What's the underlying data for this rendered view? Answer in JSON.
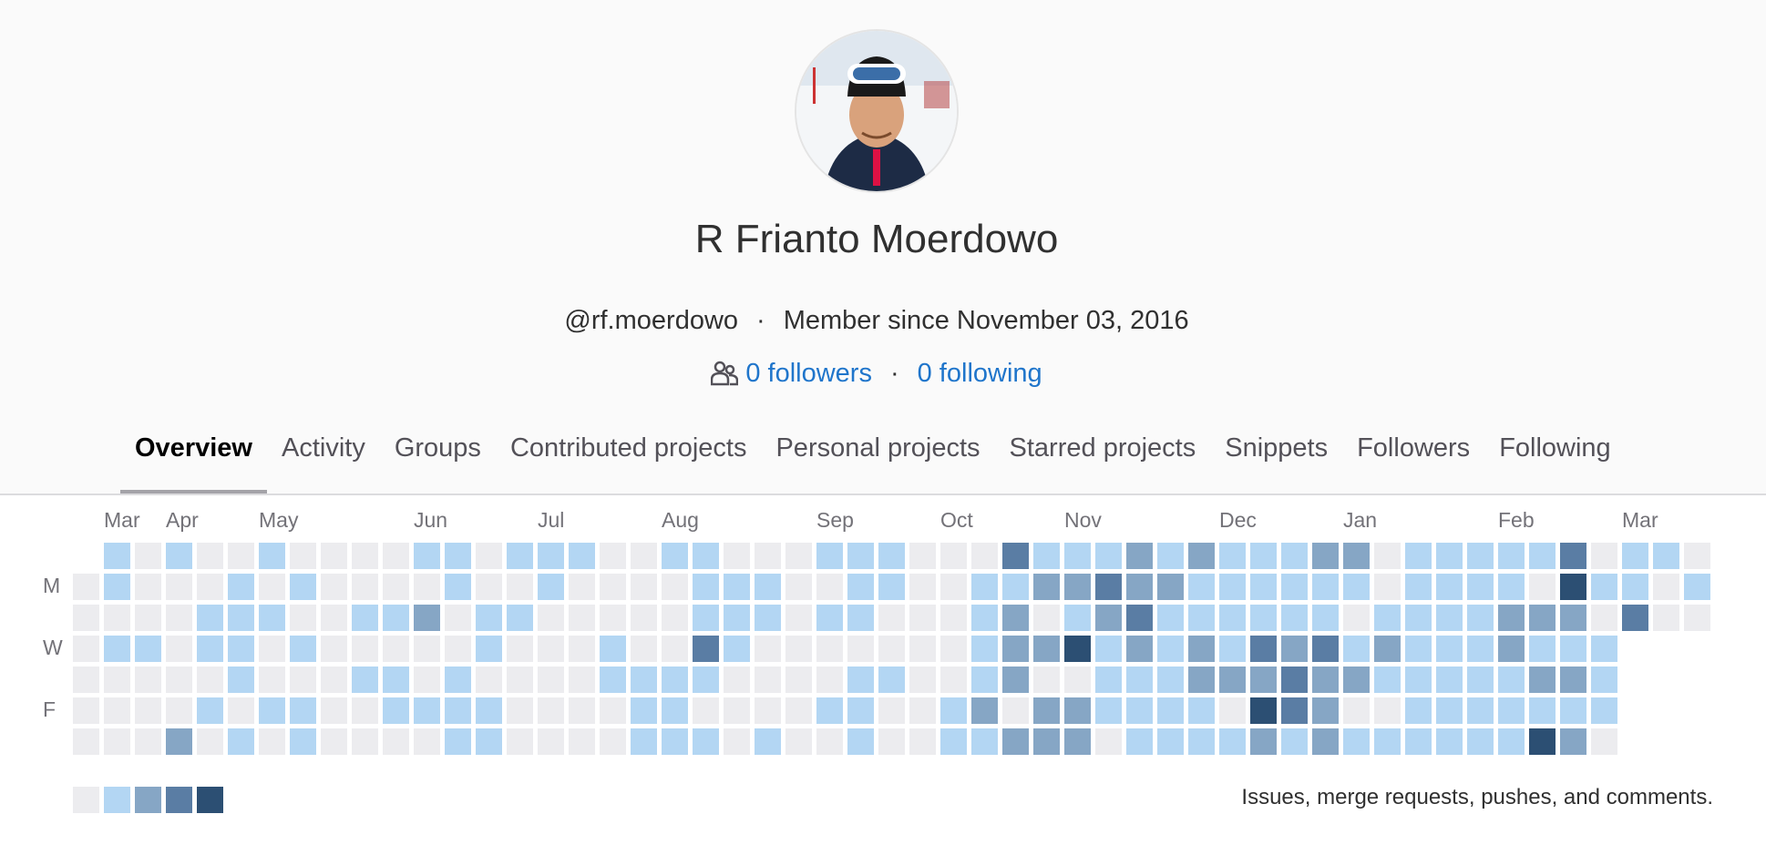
{
  "profile": {
    "name": "R Frianto Moerdowo",
    "username": "@rf.moerdowo",
    "member_since": "Member since November 03, 2016",
    "followers": "0 followers",
    "following": "0 following",
    "separator": "·"
  },
  "tabs": [
    {
      "label": "Overview",
      "active": true
    },
    {
      "label": "Activity"
    },
    {
      "label": "Groups"
    },
    {
      "label": "Contributed projects"
    },
    {
      "label": "Personal projects"
    },
    {
      "label": "Starred projects"
    },
    {
      "label": "Snippets"
    },
    {
      "label": "Followers"
    },
    {
      "label": "Following"
    }
  ],
  "calendar": {
    "months": [
      "Mar",
      "Apr",
      "May",
      "Jun",
      "Jul",
      "Aug",
      "Sep",
      "Oct",
      "Nov",
      "Dec",
      "Jan",
      "Feb",
      "Mar"
    ],
    "day_labels": [
      "M",
      "W",
      "F"
    ],
    "legend_text": "Issues, merge requests, pushes, and comments.",
    "level_colors": [
      "#ececef",
      "#b3d6f3",
      "#86a6c5",
      "#5a7da4",
      "#2c4f73"
    ],
    "rows": [
      "x1010010000110111001100011100031112121112201111130110",
      "01000101000010010000111001100112232211111101111041101",
      "00001110011201100000111011000120123111111011112220300",
      "01101101000001000100310000000122412121323121112111",
      "00000100011010000111100001100120011122232211111221",
      "00001011001111000011000011001202211110432001111111",
      "00020101000011000011101001001122201111212111111420"
    ]
  }
}
